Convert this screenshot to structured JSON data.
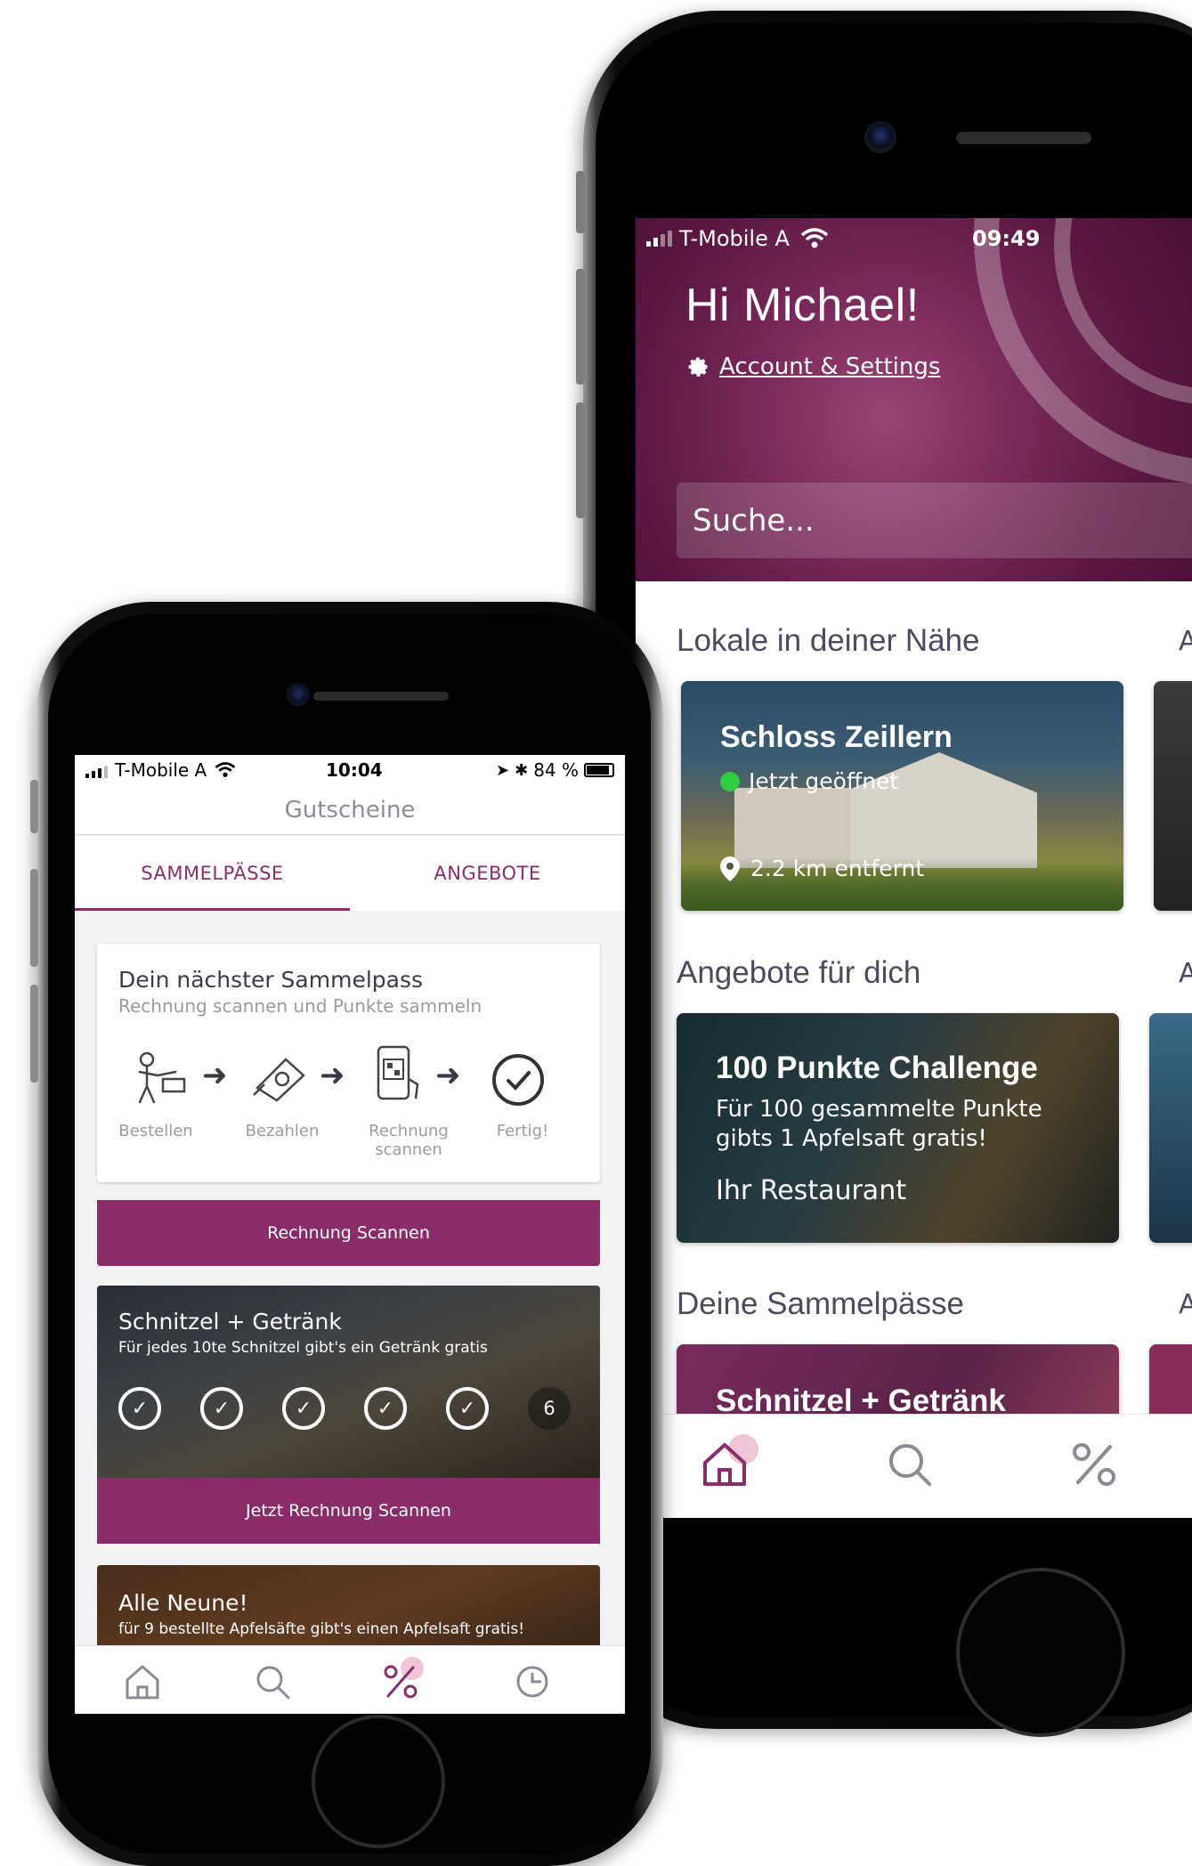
{
  "back_phone": {
    "status": {
      "carrier": "T-Mobile A",
      "time": "09:49"
    },
    "greeting": "Hi Michael!",
    "account_link": "Account & Settings",
    "search_placeholder": "Suche...",
    "sections": {
      "nearby": {
        "title": "Lokale in deiner Nähe",
        "more": "A"
      },
      "offers": {
        "title": "Angebote für dich",
        "more": "A"
      },
      "passes": {
        "title": "Deine Sammelpässe",
        "more": "A"
      }
    },
    "venue_card": {
      "name": "Schloss Zeillern",
      "status": "Jetzt geöffnet",
      "distance": "2.2 km entfernt"
    },
    "offer_card": {
      "title": "100 Punkte Challenge",
      "description": "Für 100 gesammelte Punkte gibts 1 Apfelsaft gratis!",
      "venue": "Ihr Restaurant"
    },
    "pass_card": {
      "title": "Schnitzel + Getränk"
    },
    "tabbar": {
      "items": [
        "home-icon",
        "search-icon",
        "percent-icon"
      ],
      "active": "home-icon"
    }
  },
  "front_phone": {
    "status": {
      "carrier": "T-Mobile A",
      "time": "10:04",
      "battery": "84 %"
    },
    "nav_title": "Gutscheine",
    "tabs": [
      {
        "label": "SAMMELPÄSSE",
        "active": true
      },
      {
        "label": "ANGEBOTE",
        "active": false
      }
    ],
    "next_pass": {
      "title": "Dein nächster Sammelpass",
      "subtitle": "Rechnung scannen und Punkte sammeln",
      "steps": [
        "Bestellen",
        "Bezahlen",
        "Rechnung scannen",
        "Fertig!"
      ],
      "button": "Rechnung Scannen"
    },
    "pass_schnitzel": {
      "title": "Schnitzel + Getränk",
      "subtitle": "Für jedes 10te Schnitzel gibt's ein Getränk gratis",
      "stamps_collected": 5,
      "next_stamp_number": "6",
      "button": "Jetzt Rechnung Scannen"
    },
    "pass_neune": {
      "title": "Alle Neune!",
      "subtitle": "für 9 bestellte Apfelsäfte gibt's einen Apfelsaft gratis!"
    },
    "tabbar": {
      "items": [
        "home-icon",
        "search-icon",
        "percent-icon",
        "history-icon"
      ],
      "active": "percent-icon"
    },
    "colors": {
      "accent": "#8a2c6a",
      "muted": "#8d8d9a"
    }
  }
}
